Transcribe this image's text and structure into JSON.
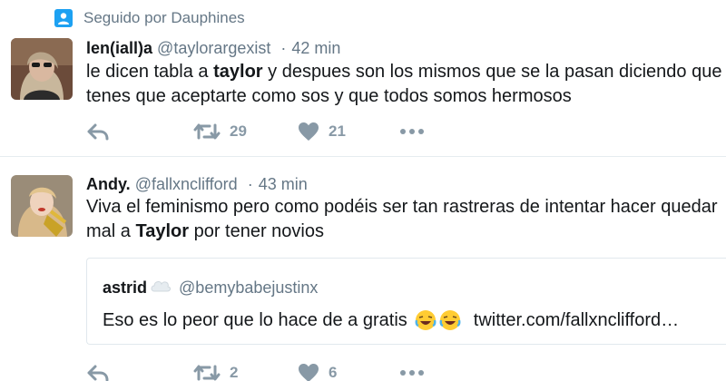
{
  "context": {
    "text": "Seguido por Dauphines"
  },
  "tweets": [
    {
      "name": "len(iall)a",
      "handle": "@taylorargexist",
      "dot": "·",
      "time": "42 min",
      "line1_a": "le dicen tabla a ",
      "line1_b": "taylor",
      "line1_c": " y despues son los mismos que se la pasan diciendo que",
      "line2": "tenes que aceptarte como sos y que todos somos hermosos",
      "retweets": "29",
      "likes": "21"
    },
    {
      "name": "Andy.",
      "handle": "@fallxnclifford",
      "dot": "·",
      "time": "43 min",
      "line1": "Viva el feminismo pero como podéis ser tan rastreras de intentar hacer quedar",
      "line2_a": "mal a ",
      "line2_b": "Taylor",
      "line2_c": " por tener novios",
      "retweets": "2",
      "likes": "6",
      "quote": {
        "name": "astrid",
        "handle": "@bemybabejustinx",
        "text": "Eso es lo peor que lo hace de a gratis",
        "link": "twitter.com/fallxnclifford…"
      }
    }
  ],
  "colors": {
    "muted": "#657786",
    "icon": "#8899a6",
    "text": "#14171a",
    "accent": "#1da1f2"
  },
  "icons": [
    "person-icon",
    "reply-icon",
    "retweet-icon",
    "heart-icon",
    "more-icon",
    "cloud-icon",
    "laughing-emoji-icon"
  ]
}
